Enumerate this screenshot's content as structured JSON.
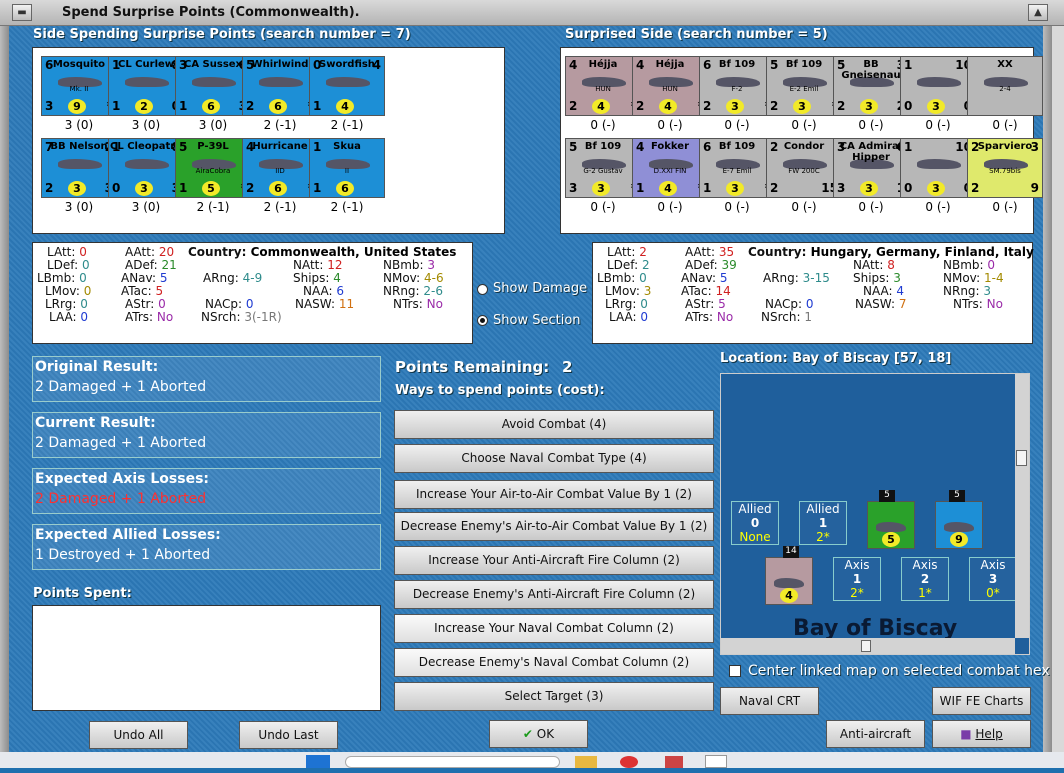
{
  "window": {
    "title": "Spend Surprise Points (Commonwealth)."
  },
  "left_title": "Side Spending Surprise Points (search number = 7)",
  "right_title": "Surprised Side (search number = 5)",
  "left_counters": [
    {
      "name": "Mosquito",
      "sub": "Mk. II",
      "tl": "6",
      "tr": "",
      "bl": "3",
      "br": "*",
      "bm": "9",
      "cap": "3 (0)",
      "color": "blue"
    },
    {
      "name": "CL Curlew",
      "sub": "",
      "tl": "1",
      "tr": "8",
      "bl": "1",
      "br": "0",
      "bm": "2",
      "cap": "3 (0)",
      "color": "blue"
    },
    {
      "name": "CA Sussex",
      "sub": "",
      "tl": "3",
      "tr": "6",
      "bl": "1",
      "br": "3",
      "bm": "6",
      "cap": "3 (0)",
      "color": "blue"
    },
    {
      "name": "Whirlwind",
      "sub": "",
      "tl": "5",
      "tr": "",
      "bl": "2",
      "br": "*",
      "bm": "6",
      "cap": "2 (-1)",
      "color": "blue"
    },
    {
      "name": "Swordfish",
      "sub": "",
      "tl": "0",
      "tr": "4",
      "bl": "1",
      "br": "",
      "bm": "4",
      "cap": "2 (-1)",
      "color": "blue"
    },
    {
      "name": "BB Nelson",
      "sub": "",
      "tl": "7",
      "tr": "2",
      "bl": "2",
      "br": "3",
      "bm": "3",
      "cap": "3 (0)",
      "color": "blue"
    },
    {
      "name": "CL Cleopatra",
      "sub": "",
      "tl": "1",
      "tr": "8",
      "bl": "0",
      "br": "3",
      "bm": "3",
      "cap": "3 (0)",
      "color": "blue"
    },
    {
      "name": "P-39L",
      "sub": "AiraCobra",
      "tl": "5",
      "tr": "",
      "bl": "1",
      "br": "*",
      "bm": "5",
      "cap": "2 (-1)",
      "color": "green"
    },
    {
      "name": "Hurricane",
      "sub": "IID",
      "tl": "4",
      "tr": "",
      "bl": "2",
      "br": "*",
      "bm": "6",
      "cap": "2 (-1)",
      "color": "blue"
    },
    {
      "name": "Skua",
      "sub": "II",
      "tl": "1",
      "tr": "",
      "bl": "1",
      "br": "",
      "bm": "6",
      "cap": "2 (-1)",
      "color": "blue"
    }
  ],
  "right_counters": [
    {
      "name": "Héjja",
      "sub": "HUN",
      "tl": "4",
      "tr": "",
      "bl": "2",
      "br": "*",
      "bm": "4",
      "cap": "0 (-)",
      "color": "mauve"
    },
    {
      "name": "Héjja",
      "sub": "HUN",
      "tl": "4",
      "tr": "",
      "bl": "2",
      "br": "*",
      "bm": "4",
      "cap": "0 (-)",
      "color": "mauve"
    },
    {
      "name": "Bf 109",
      "sub": "F-2",
      "tl": "6",
      "tr": "",
      "bl": "2",
      "br": "*",
      "bm": "3",
      "cap": "0 (-)",
      "color": "grey"
    },
    {
      "name": "Bf 109",
      "sub": "E-2 Emil",
      "tl": "5",
      "tr": "",
      "bl": "2",
      "br": "*",
      "bm": "3",
      "cap": "0 (-)",
      "color": "grey"
    },
    {
      "name": "BB Gneisenau",
      "sub": "",
      "tl": "5",
      "tr": "3",
      "bl": "2",
      "br": "2",
      "bm": "3",
      "cap": "0 (-)",
      "color": "grey"
    },
    {
      "name": "",
      "sub": "",
      "tl": "1",
      "tr": "10",
      "bl": "0",
      "br": "0",
      "bm": "3",
      "cap": "0 (-)",
      "color": "grey"
    },
    {
      "name": "XX",
      "sub": "2-4",
      "tl": "",
      "tr": "",
      "bl": "",
      "br": "",
      "bm": "",
      "cap": "0 (-)",
      "color": "grey"
    },
    {
      "name": "Bf 109",
      "sub": "G-2 Gustav",
      "tl": "5",
      "tr": "",
      "bl": "3",
      "br": "*",
      "bm": "3",
      "cap": "0 (-)",
      "color": "grey"
    },
    {
      "name": "Fokker",
      "sub": "D.XXI FIN",
      "tl": "4",
      "tr": "",
      "bl": "1",
      "br": "*",
      "bm": "4",
      "cap": "0 (-)",
      "color": "purple"
    },
    {
      "name": "Bf 109",
      "sub": "E-7 Emil",
      "tl": "6",
      "tr": "",
      "bl": "1",
      "br": "*",
      "bm": "3",
      "cap": "0 (-)",
      "color": "grey"
    },
    {
      "name": "Condor",
      "sub": "FW 200C",
      "tl": "2",
      "tr": "",
      "bl": "2",
      "br": "15",
      "bm": "",
      "cap": "0 (-)",
      "color": "grey"
    },
    {
      "name": "CA Admiral Hipper",
      "sub": "",
      "tl": "3",
      "tr": "6",
      "bl": "3",
      "br": "1",
      "bm": "3",
      "cap": "0 (-)",
      "color": "grey"
    },
    {
      "name": "",
      "sub": "",
      "tl": "1",
      "tr": "10",
      "bl": "0",
      "br": "0",
      "bm": "3",
      "cap": "0 (-)",
      "color": "grey"
    },
    {
      "name": "Sparviero",
      "sub": "SM.79bis",
      "tl": "2",
      "tr": "3",
      "bl": "2",
      "br": "9",
      "bm": "",
      "cap": "0 (-)",
      "color": "yel"
    }
  ],
  "left_stats": {
    "LAtt": "0",
    "LDef": "0",
    "LBmb": "0",
    "LMov": "0",
    "LRrg": "0",
    "LAA": "0",
    "AAtt": "20",
    "ADef": "21",
    "ANav": "5",
    "ATac": "5",
    "AStr": "0",
    "ATrs": "No",
    "Country": "Commonwealth, United States",
    "ARng": "4-9",
    "NAtt": "12",
    "Ships": "4",
    "NAA": "6",
    "NASW": "11",
    "NBmb": "3",
    "NMov": "4-6",
    "NRng": "2-6",
    "NTrs": "No",
    "NACp": "0",
    "NSrch": "3(-1R)"
  },
  "right_stats": {
    "LAtt": "2",
    "LDef": "2",
    "LBmb": "0",
    "LMov": "3",
    "LRrg": "0",
    "LAA": "0",
    "AAtt": "35",
    "ADef": "39",
    "ANav": "5",
    "ATac": "14",
    "AStr": "5",
    "ATrs": "No",
    "Country": "Hungary, Germany, Finland, Italy",
    "ARng": "3-15",
    "NAtt": "8",
    "Ships": "3",
    "NAA": "4",
    "NASW": "7",
    "NBmb": "0",
    "NMov": "1-4",
    "NRng": "3",
    "NTrs": "No",
    "NACp": "0",
    "NSrch": "1"
  },
  "radio": {
    "show_damage": "Show Damage",
    "show_section": "Show Section"
  },
  "results": [
    {
      "label": "Original Result:",
      "value": "2 Damaged + 1 Aborted",
      "color": "#ffffff"
    },
    {
      "label": "Current Result:",
      "value": "2 Damaged + 1 Aborted",
      "color": "#ffffff"
    },
    {
      "label": "Expected Axis Losses:",
      "value": "2 Damaged + 1 Aborted",
      "color": "#ff3030"
    },
    {
      "label": "Expected Allied Losses:",
      "value": "1 Destroyed + 1 Aborted",
      "color": "#ffffff"
    }
  ],
  "points_spent_label": "Points Spent:",
  "points_remaining_label": "Points Remaining:",
  "points_remaining_value": "2",
  "ways_label": "Ways to spend points (cost):",
  "spend_buttons": [
    "Avoid Combat (4)",
    "Choose Naval Combat Type (4)",
    "Increase Your Air-to-Air Combat Value By 1 (2)",
    "Decrease Enemy's Air-to-Air Combat Value By 1 (2)",
    "Increase Your Anti-Aircraft Fire Column (2)",
    "Decrease Enemy's Anti-Aircraft Fire Column (2)",
    "Increase Your Naval Combat Column (2)",
    "Decrease Enemy's Naval Combat Column (2)",
    "Select Target (3)"
  ],
  "location": "Location: Bay of Biscay [57, 18]",
  "map": {
    "allied": [
      {
        "h": "Allied",
        "n": "0",
        "s": "None"
      },
      {
        "h": "Allied",
        "n": "1",
        "s": "2*"
      }
    ],
    "axis": [
      {
        "h": "Axis",
        "n": "1",
        "s": "2*"
      },
      {
        "h": "Axis",
        "n": "2",
        "s": "1*"
      },
      {
        "h": "Axis",
        "n": "3",
        "s": "0*"
      }
    ],
    "sea_label": "Bay of Biscay",
    "stack1": "5",
    "stack2": "5",
    "stack3": "14"
  },
  "center_linked": "Center linked map on selected combat hex",
  "buttons": {
    "naval_crt": "Naval CRT",
    "wif_charts": "WIF FE Charts",
    "aa_crt": "Anti-aircraft CRT",
    "help": "Help",
    "undo_all": "Undo All",
    "undo_last": "Undo Last",
    "ok": "OK"
  }
}
